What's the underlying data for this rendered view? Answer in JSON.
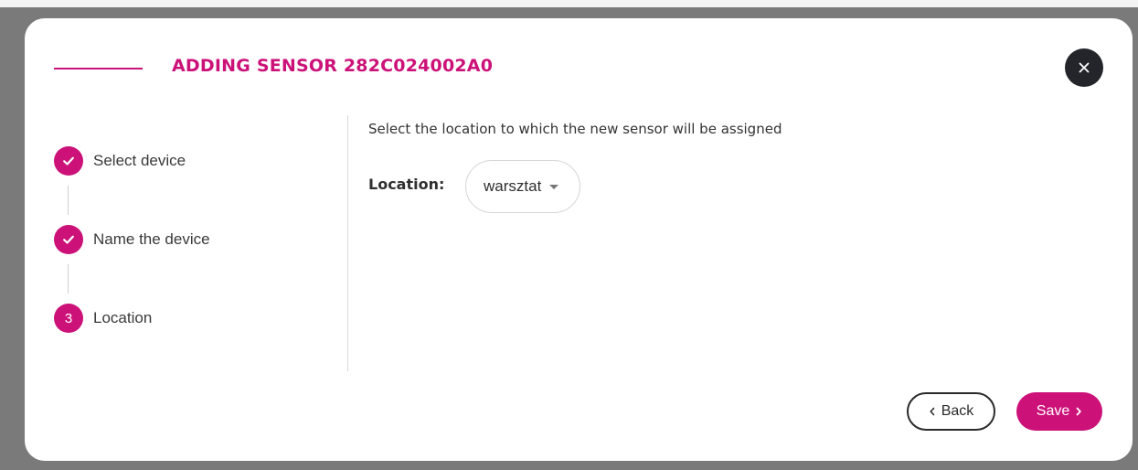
{
  "dialog": {
    "title": "ADDING SENSOR 282C024002A0",
    "close_icon": "close-icon"
  },
  "steps": [
    {
      "label": "Select device",
      "state": "completed",
      "icon": "check-icon"
    },
    {
      "label": "Name the device",
      "state": "completed",
      "icon": "check-icon"
    },
    {
      "label": "Location",
      "state": "active",
      "number": "3"
    }
  ],
  "content": {
    "instruction": "Select the location to which the new sensor will be assigned",
    "location_label": "Location:",
    "location_value": "warsztat"
  },
  "footer": {
    "back_label": "Back",
    "save_label": "Save"
  },
  "colors": {
    "accent": "#cc1279",
    "close_bg": "#23252b",
    "overlay": "#7a7a7a"
  }
}
